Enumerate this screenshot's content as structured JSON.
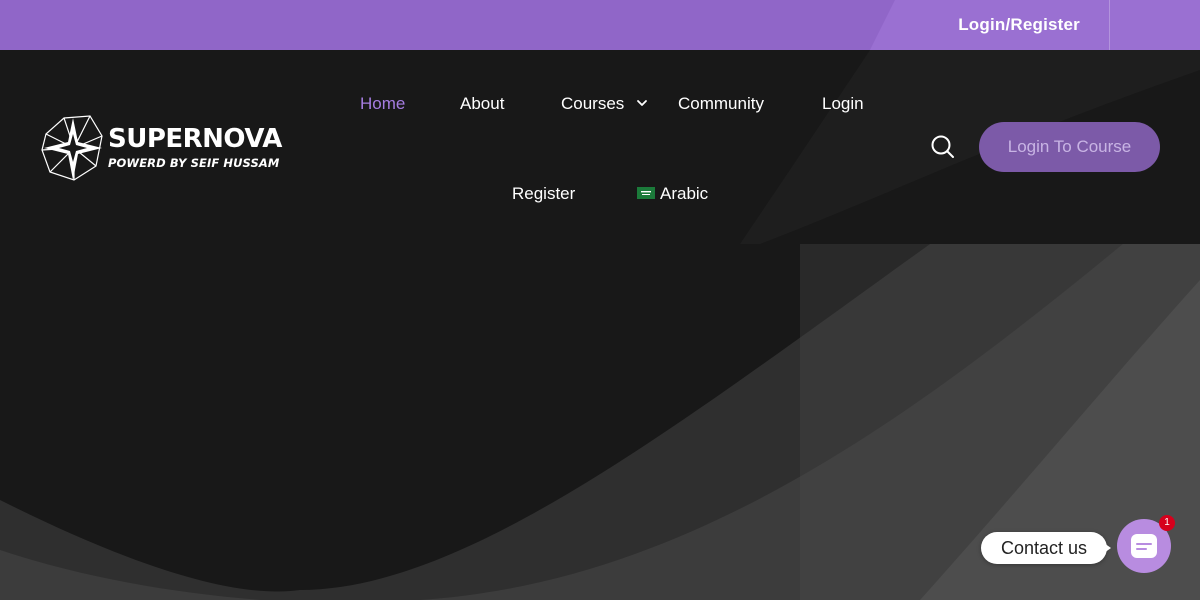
{
  "top_bar": {
    "login_register_label": "Login/Register"
  },
  "logo": {
    "title": "SUPERNOVA",
    "tagline": "POWERD BY SEIF HUSSAM"
  },
  "nav": {
    "items": [
      {
        "label": "Home",
        "active": true
      },
      {
        "label": "About"
      },
      {
        "label": "Courses",
        "has_submenu": true
      },
      {
        "label": "Community"
      },
      {
        "label": "Login"
      },
      {
        "label": "Register"
      },
      {
        "label": "Arabic",
        "icon": "saudi-flag-icon"
      }
    ]
  },
  "header_actions": {
    "search_icon": "search-icon",
    "login_course_label": "Login To Course"
  },
  "contact_widget": {
    "label": "Contact us",
    "badge_count": "1",
    "icon": "chat-icon"
  },
  "colors": {
    "accent": "#9066c8",
    "active_nav": "#a57de0",
    "button": "#7c5aa8",
    "background": "#181818",
    "badge": "#d6001c"
  }
}
